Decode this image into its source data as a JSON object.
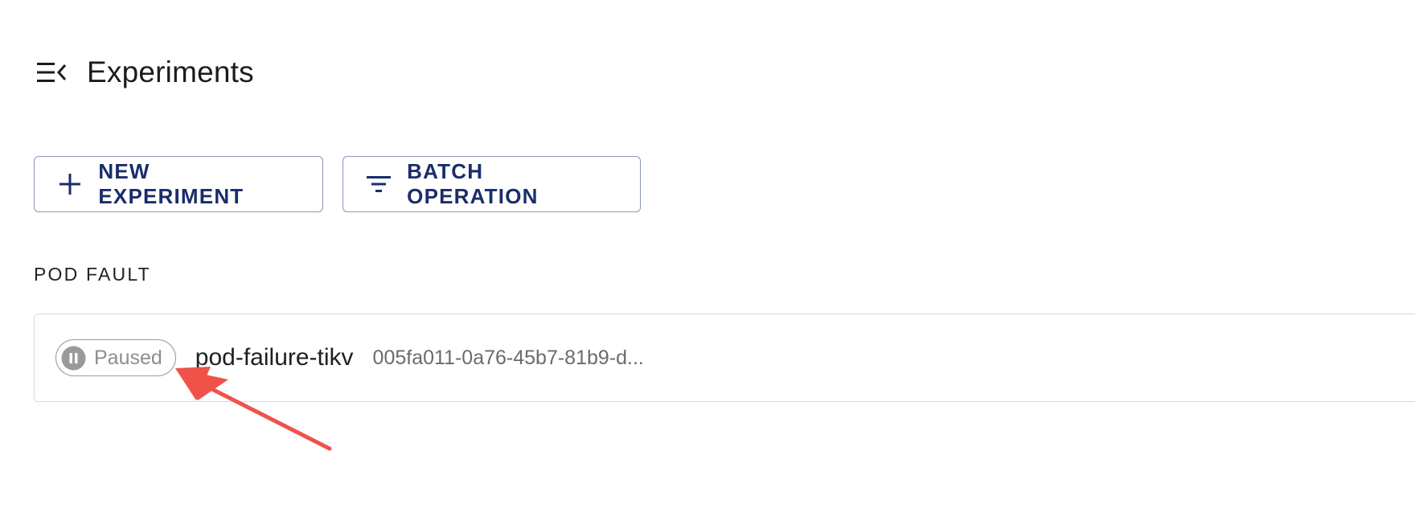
{
  "header": {
    "title": "Experiments",
    "menu_icon": "menu-open-icon"
  },
  "toolbar": {
    "new_experiment_label": "NEW EXPERIMENT",
    "new_experiment_icon": "plus-icon",
    "batch_operation_label": "BATCH OPERATION",
    "batch_operation_icon": "filter-list-icon"
  },
  "sections": [
    {
      "label": "POD FAULT",
      "experiments": [
        {
          "status": "Paused",
          "status_icon": "pause-circle-icon",
          "name": "pod-failure-tikv",
          "uid": "005fa011-0a76-45b7-81b9-d..."
        }
      ]
    }
  ],
  "colors": {
    "primary": "#1a2d6b",
    "button_border": "#8a96bd",
    "status_paused": "#9a9a9a",
    "annotation_arrow": "#f0524a"
  }
}
